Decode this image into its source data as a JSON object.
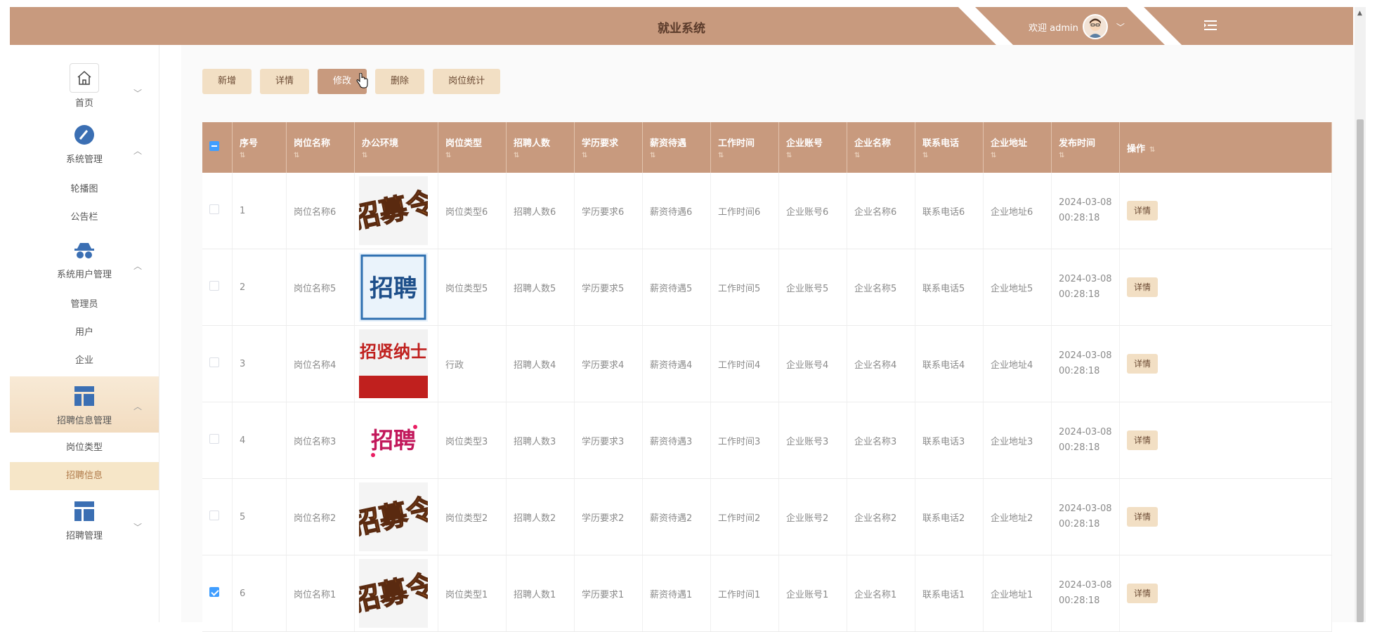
{
  "header": {
    "title": "就业系统",
    "welcome": "欢迎 admin",
    "user_chevron": "﹀"
  },
  "sidebar": {
    "groups": [
      {
        "label": "首页",
        "icon": "home-icon",
        "chevron": "﹀"
      },
      {
        "label": "系统管理",
        "icon": "gauge-icon",
        "chevron": "︿",
        "items": [
          "轮播图",
          "公告栏"
        ]
      },
      {
        "label": "系统用户管理",
        "icon": "incognito-icon",
        "chevron": "︿",
        "items": [
          "管理员",
          "用户",
          "企业"
        ]
      },
      {
        "label": "招聘信息管理",
        "icon": "layout-icon",
        "chevron": "︿",
        "items": [
          "岗位类型",
          "招聘信息"
        ]
      },
      {
        "label": "招聘管理",
        "icon": "layout-icon",
        "chevron": "﹀"
      }
    ],
    "active_item": "招聘信息"
  },
  "toolbar": {
    "add": "新增",
    "detail": "详情",
    "edit": "修改",
    "delete": "删除",
    "stats": "岗位统计"
  },
  "table": {
    "columns": [
      "序号",
      "岗位名称",
      "办公环境",
      "岗位类型",
      "招聘人数",
      "学历要求",
      "薪资待遇",
      "工作时间",
      "企业账号",
      "企业名称",
      "联系电话",
      "企业地址",
      "发布时间",
      "操作"
    ],
    "sort_mark": "⇅",
    "rows": [
      {
        "checked": false,
        "no": "1",
        "name": "岗位名称6",
        "image": "poster-orange",
        "type": "岗位类型6",
        "count": "招聘人数6",
        "edu": "学历要求6",
        "salary": "薪资待遇6",
        "time": "工作时间6",
        "account": "企业账号6",
        "company": "企业名称6",
        "phone": "联系电话6",
        "address": "企业地址6",
        "date": "2024-03-08",
        "clock": "00:28:18",
        "action": "详情"
      },
      {
        "checked": false,
        "no": "2",
        "name": "岗位名称5",
        "image": "poster-blue",
        "type": "岗位类型5",
        "count": "招聘人数5",
        "edu": "学历要求5",
        "salary": "薪资待遇5",
        "time": "工作时间5",
        "account": "企业账号5",
        "company": "企业名称5",
        "phone": "联系电话5",
        "address": "企业地址5",
        "date": "2024-03-08",
        "clock": "00:28:18",
        "action": "详情"
      },
      {
        "checked": false,
        "no": "3",
        "name": "岗位名称4",
        "image": "poster-red",
        "type": "行政",
        "count": "招聘人数4",
        "edu": "学历要求4",
        "salary": "薪资待遇4",
        "time": "工作时间4",
        "account": "企业账号4",
        "company": "企业名称4",
        "phone": "联系电话4",
        "address": "企业地址4",
        "date": "2024-03-08",
        "clock": "00:28:18",
        "action": "详情"
      },
      {
        "checked": false,
        "no": "4",
        "name": "岗位名称3",
        "image": "poster-pink",
        "type": "岗位类型3",
        "count": "招聘人数3",
        "edu": "学历要求3",
        "salary": "薪资待遇3",
        "time": "工作时间3",
        "account": "企业账号3",
        "company": "企业名称3",
        "phone": "联系电话3",
        "address": "企业地址3",
        "date": "2024-03-08",
        "clock": "00:28:18",
        "action": "详情"
      },
      {
        "checked": false,
        "no": "5",
        "name": "岗位名称2",
        "image": "poster-orange",
        "type": "岗位类型2",
        "count": "招聘人数2",
        "edu": "学历要求2",
        "salary": "薪资待遇2",
        "time": "工作时间2",
        "account": "企业账号2",
        "company": "企业名称2",
        "phone": "联系电话2",
        "address": "企业地址2",
        "date": "2024-03-08",
        "clock": "00:28:18",
        "action": "详情"
      },
      {
        "checked": true,
        "no": "6",
        "name": "岗位名称1",
        "image": "poster-orange",
        "type": "岗位类型1",
        "count": "招聘人数1",
        "edu": "学历要求1",
        "salary": "薪资待遇1",
        "time": "工作时间1",
        "account": "企业账号1",
        "company": "企业名称1",
        "phone": "联系电话1",
        "address": "企业地址1",
        "date": "2024-03-08",
        "clock": "00:28:18",
        "action": "详情"
      }
    ]
  },
  "colors": {
    "accent": "#c89a7e",
    "button": "#f2dfc4",
    "checkbox": "#409eff"
  }
}
